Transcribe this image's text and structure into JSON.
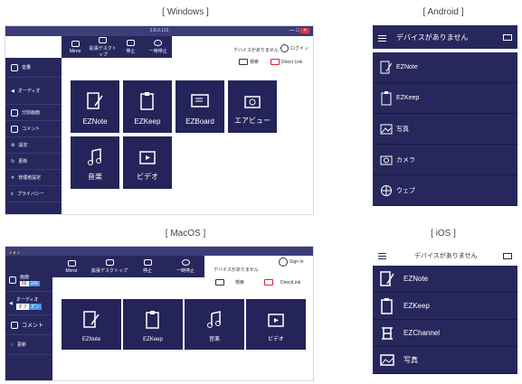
{
  "captions": {
    "windows": "[ Windows ]",
    "android": "[ Android ]",
    "macos": "[ MacOS ]",
    "ios": "[ iOS ]"
  },
  "windows": {
    "version": "2.8.0.115",
    "toolbar": [
      {
        "label": "Mirror",
        "icon": "mirror-icon"
      },
      {
        "label": "拡張デスクトップ",
        "icon": "extend-desktop-icon"
      },
      {
        "label": "停止",
        "icon": "stop-icon"
      },
      {
        "label": "一時停止",
        "icon": "pause-icon"
      }
    ],
    "status": "デバイスがありません",
    "login": "ログイン",
    "search": "検索",
    "direct_link": "Direct Link",
    "sidebar": [
      "音量",
      "オーディオ",
      "分割画面",
      "コメント",
      "設定",
      "更新",
      "管理者設定",
      "プライバシー"
    ],
    "tiles": [
      "EZNote",
      "EZKeep",
      "EZBoard",
      "エアビュー",
      "音楽",
      "ビデオ"
    ]
  },
  "android": {
    "header": "デバイスがありません",
    "items": [
      "EZNote",
      "EZKeep",
      "写真",
      "カメラ",
      "ウェブ"
    ]
  },
  "macos": {
    "toolbar": [
      "Mirror",
      "拡張デスクトップ",
      "停止",
      "一時停止"
    ],
    "status": "デバイスがありません",
    "signin": "Sign In",
    "search": "検索",
    "direct_link": "DirectLink",
    "sidebar": [
      "画面",
      "オーディオ",
      "コメント",
      "更新"
    ],
    "volume_toggle": [
      "50",
      "100"
    ],
    "audio_toggle": [
      "オフ",
      "オン"
    ],
    "tiles": [
      "EZNote",
      "EZKeep",
      "音楽",
      "ビデオ"
    ]
  },
  "ios": {
    "header": "デバイスがありません",
    "items": [
      "EZNote",
      "EZKeep",
      "EZChannel",
      "写真"
    ]
  }
}
